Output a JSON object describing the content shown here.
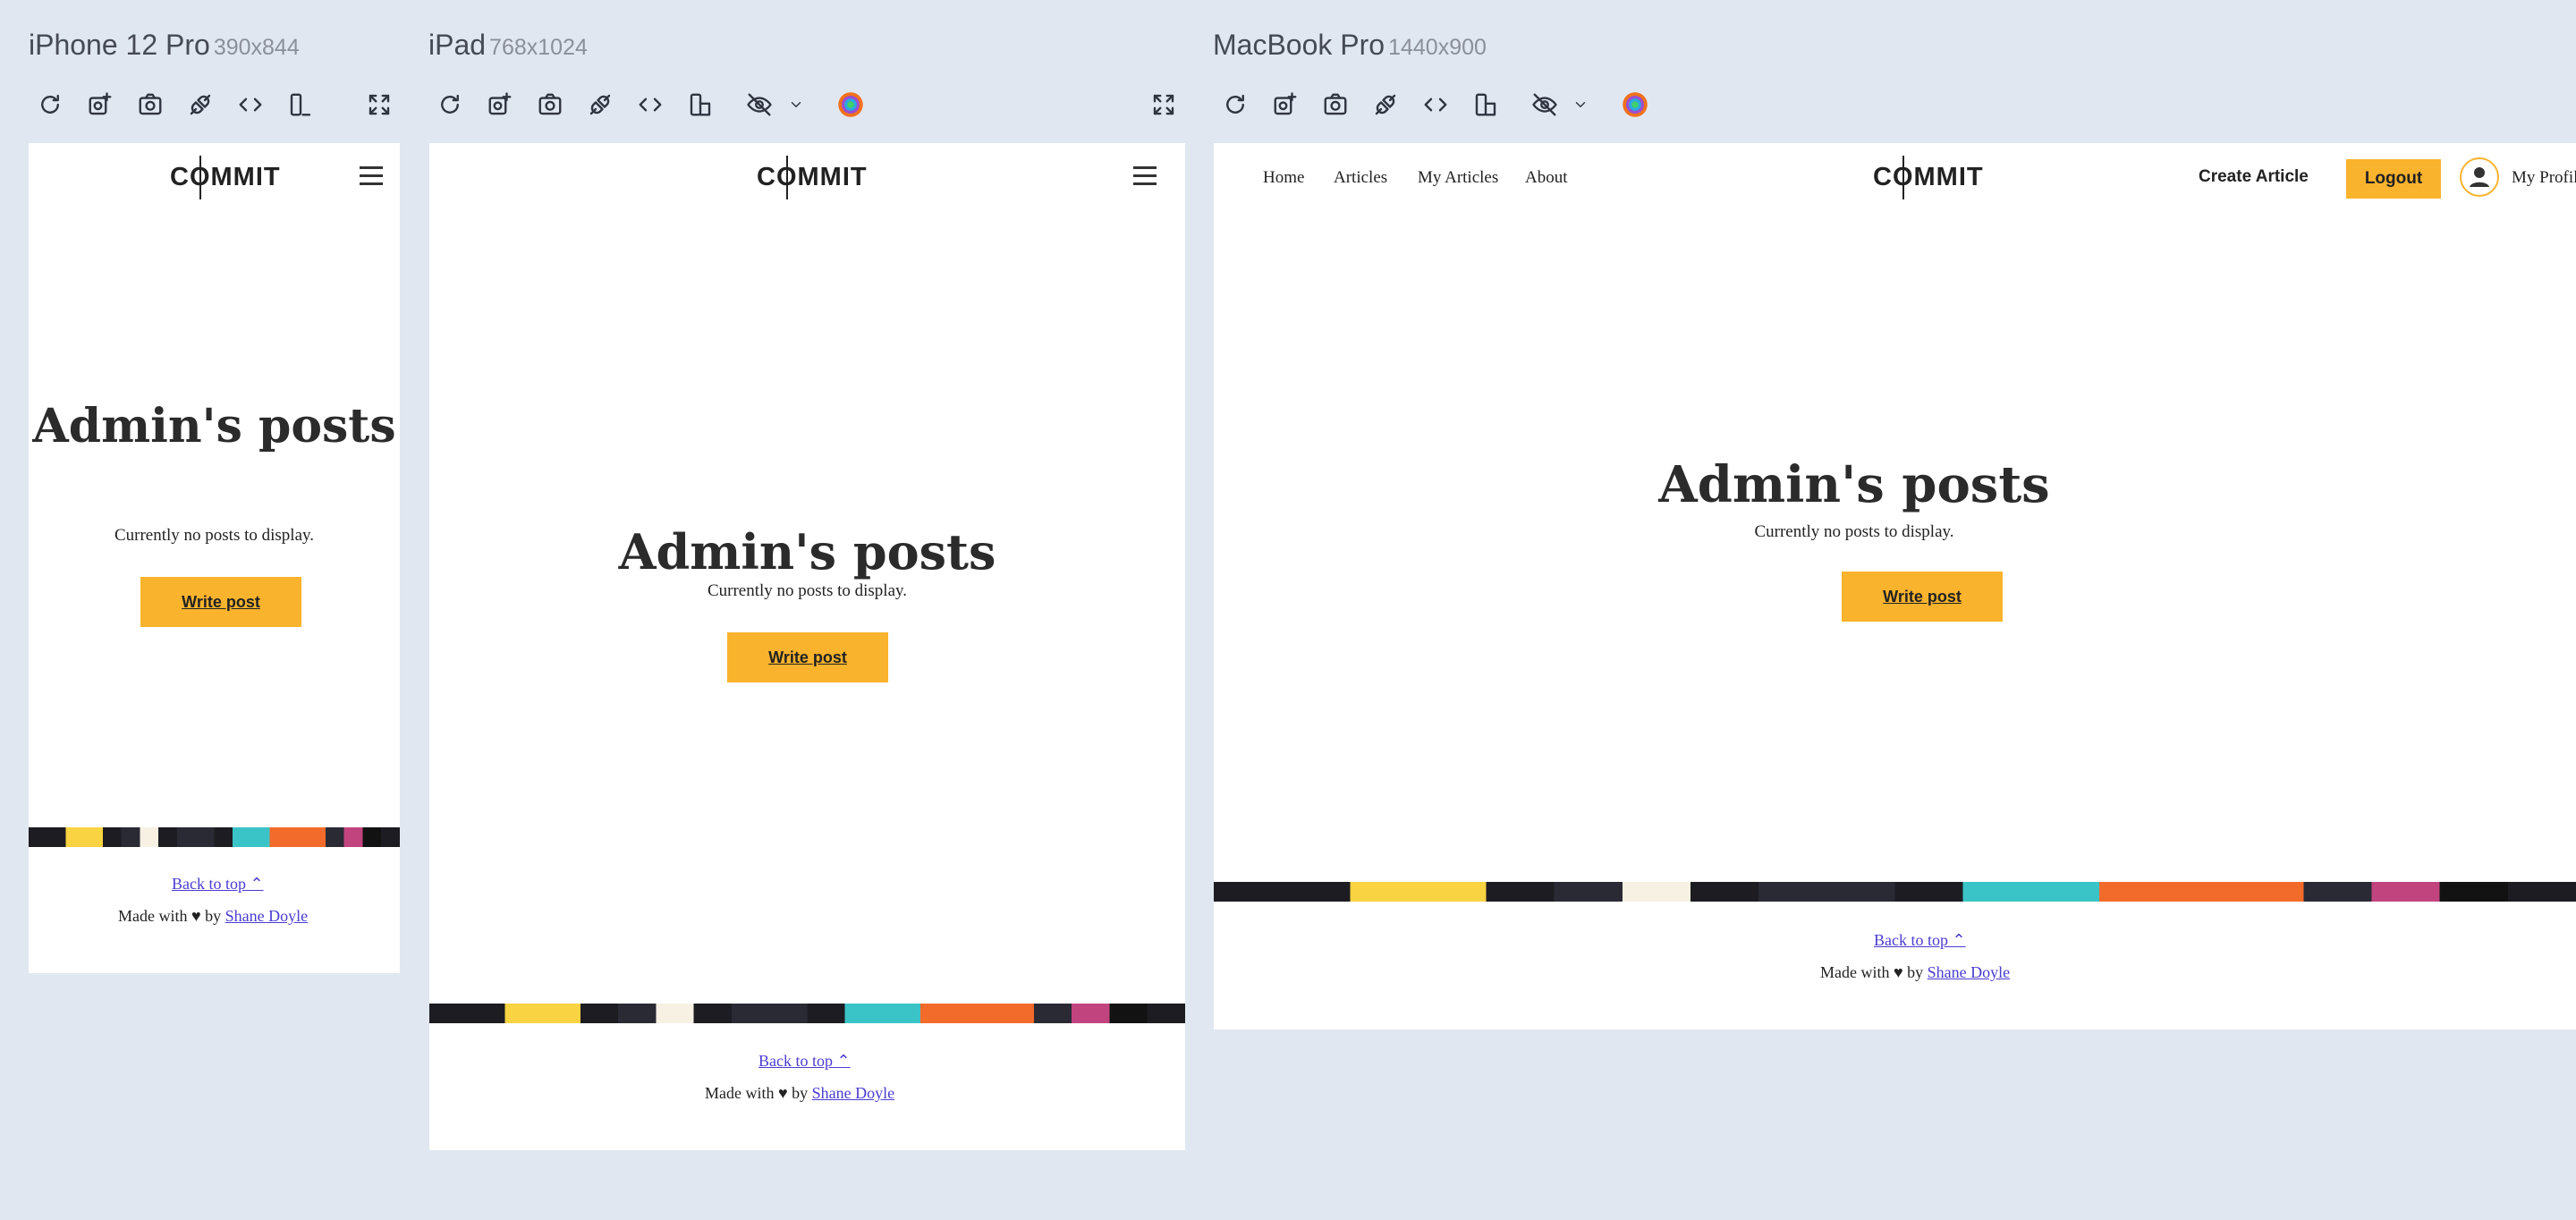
{
  "devices": {
    "iphone": {
      "name": "iPhone 12 Pro",
      "dims": "390x844"
    },
    "ipad": {
      "name": "iPad",
      "dims": "768x1024"
    },
    "macbook": {
      "name": "MacBook Pro",
      "dims": "1440x900"
    }
  },
  "toolbar": {
    "tools": [
      "refresh-icon",
      "screenshot-full-icon",
      "camera-icon",
      "sync-link-icon",
      "code-icon",
      "rotate-device-icon",
      "hide-icon",
      "chevron-down-icon",
      "browser-icon",
      "fullscreen-icon"
    ]
  },
  "site": {
    "logo": {
      "pre": "C",
      "o": "O",
      "post": "MMIT"
    },
    "nav": {
      "home": "Home",
      "articles": "Articles",
      "my_articles": "My Articles",
      "about": "About"
    },
    "create_article": "Create Article",
    "logout": "Logout",
    "my_profile": "My Profile",
    "heading": "Admin's posts",
    "no_posts": "Currently no posts to display.",
    "write_post": "Write post",
    "back_to_top": "Back to top",
    "made_with": "Made with",
    "heart": "♥",
    "by": "by",
    "author": "Shane Doyle"
  },
  "colors": {
    "accent": "#fab32d",
    "link": "#4a3cd0",
    "background": "#e1e7f1",
    "stripe": [
      "#1c1c22",
      "#f9d342",
      "#2a2a35",
      "#f7f1e3",
      "#3bc4c7",
      "#f36b2b",
      "#c2447f",
      "#121212"
    ]
  }
}
